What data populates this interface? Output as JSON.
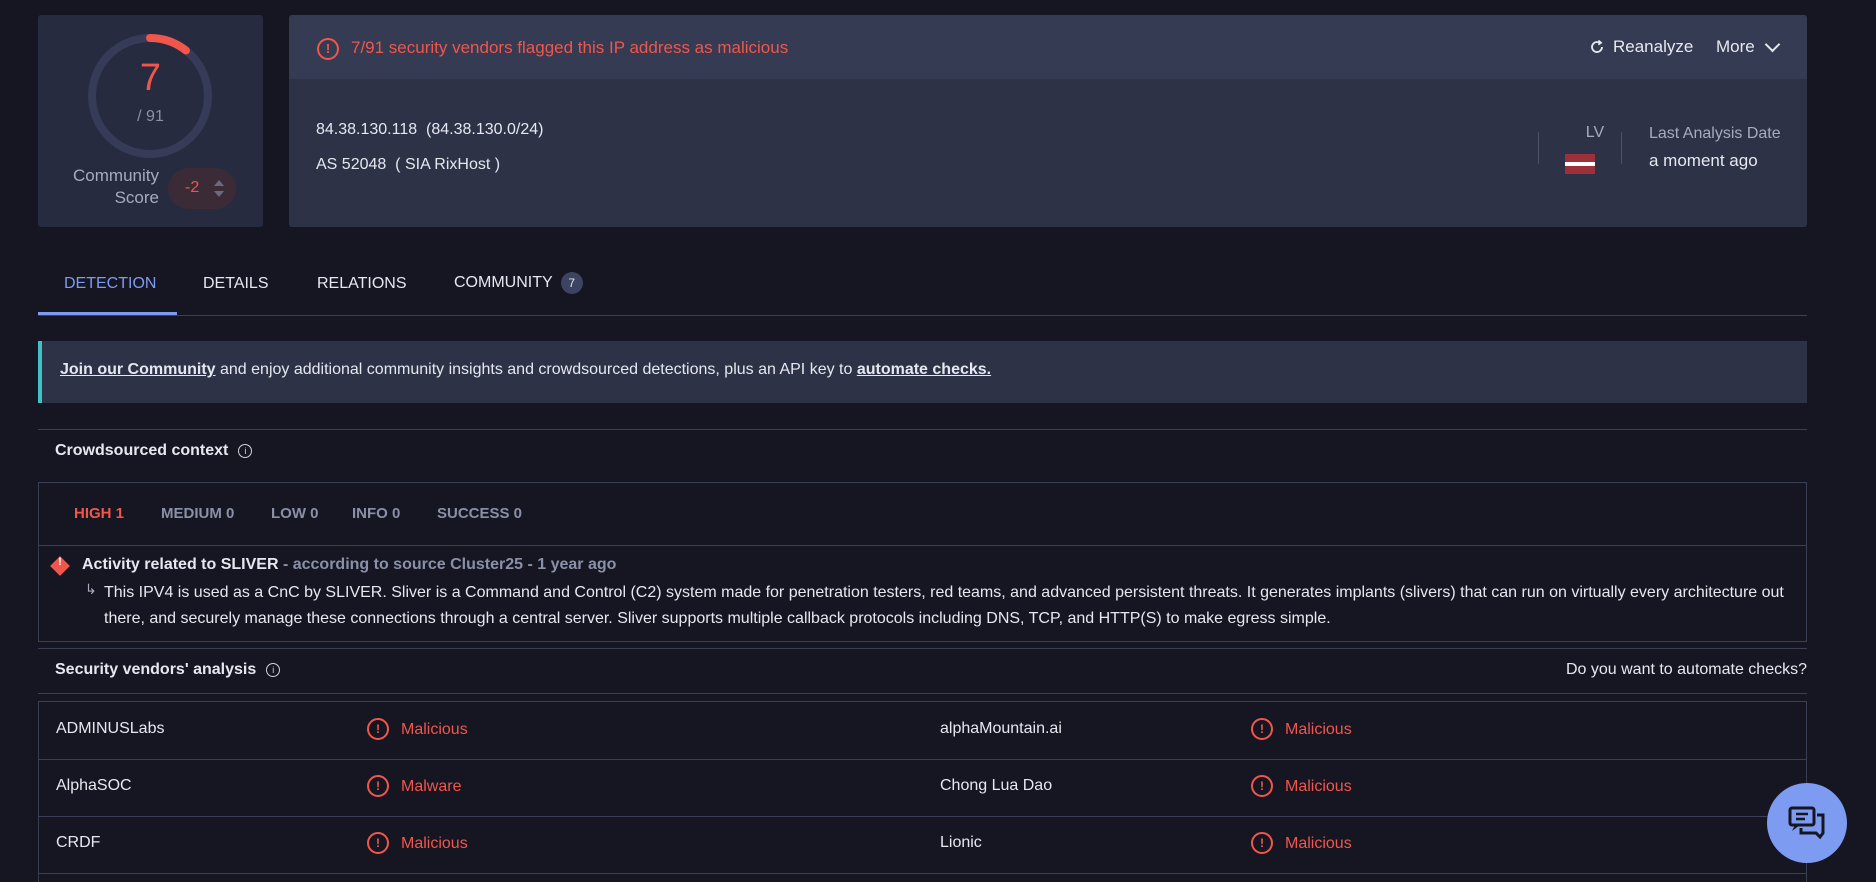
{
  "score": {
    "detected": "7",
    "total": "/ 91",
    "community_label_1": "Community",
    "community_label_2": "Score",
    "community_value": "-2"
  },
  "banner": {
    "text": "7/91 security vendors flagged this IP address as malicious",
    "reanalyze": "Reanalyze",
    "more": "More"
  },
  "ip": {
    "address_line": "84.38.130.118  (84.38.130.0/24)",
    "as_line": "AS 52048  ( SIA RixHost )",
    "country_code": "LV",
    "last_analysis_label": "Last Analysis Date",
    "last_analysis_value": "a moment ago"
  },
  "tabs": [
    {
      "label": "DETECTION"
    },
    {
      "label": "DETAILS"
    },
    {
      "label": "RELATIONS"
    },
    {
      "label": "COMMUNITY",
      "badge": "7"
    }
  ],
  "join": {
    "link1": "Join our Community",
    "middle": " and enjoy additional community insights and crowdsourced detections, plus an API key to ",
    "link2": "automate checks."
  },
  "crowdsourced": {
    "title": "Crowdsourced context",
    "filters": [
      "HIGH 1",
      "MEDIUM 0",
      "LOW 0",
      "INFO 0",
      "SUCCESS 0"
    ],
    "activity_title": "Activity related to SLIVER",
    "activity_source": " - according to source Cluster25 - 1 year ago",
    "description": "This IPV4 is used as a CnC by SLIVER. Sliver is a Command and Control (C2) system made for penetration testers, red teams, and advanced persistent threats. It generates implants (slivers) that can run on virtually every architecture out there, and securely manage these connections through a central server. Sliver supports multiple callback protocols including DNS, TCP, and HTTP(S) to make egress simple."
  },
  "vendors": {
    "title": "Security vendors' analysis",
    "automate_question": "Do you want to automate checks?",
    "rows": [
      {
        "left_name": "ADMINUSLabs",
        "left_status": "Malicious",
        "right_name": "alphaMountain.ai",
        "right_status": "Malicious"
      },
      {
        "left_name": "AlphaSOC",
        "left_status": "Malware",
        "right_name": "Chong Lua Dao",
        "right_status": "Malicious"
      },
      {
        "left_name": "CRDF",
        "left_status": "Malicious",
        "right_name": "Lionic",
        "right_status": "Malicious"
      }
    ]
  },
  "colors": {
    "accent": "#7e9bf2",
    "malicious": "#f1564b",
    "background": "#161622",
    "card": "#2d3247"
  }
}
